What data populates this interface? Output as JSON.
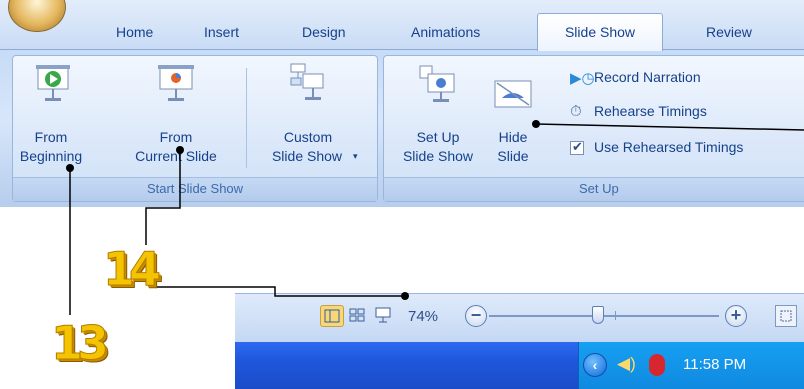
{
  "ribbon": {
    "tabs": [
      "Home",
      "Insert",
      "Design",
      "Animations",
      "Slide Show",
      "Review"
    ],
    "active_tab": "Slide Show",
    "groups": {
      "start": {
        "caption": "Start Slide Show",
        "from_beginning": [
          "From",
          "Beginning"
        ],
        "from_current": [
          "From",
          "Current Slide"
        ],
        "custom": [
          "Custom",
          "Slide Show"
        ]
      },
      "setup": {
        "caption": "Set Up",
        "set_up_show": [
          "Set Up",
          "Slide Show"
        ],
        "hide_slide": [
          "Hide",
          "Slide"
        ],
        "record_narration": "Record Narration",
        "rehearse_timings": "Rehearse Timings",
        "use_rehearsed": "Use Rehearsed Timings",
        "use_rehearsed_checked": true
      }
    }
  },
  "status": {
    "zoom": "74%"
  },
  "taskbar": {
    "clock": "11:58 PM"
  },
  "callouts": {
    "label_13": "13",
    "label_14": "14"
  },
  "colors": {
    "ribbon_text": "#15428b",
    "callout_yellow": "#f5c400",
    "taskbar_blue": "#1f57dc"
  }
}
